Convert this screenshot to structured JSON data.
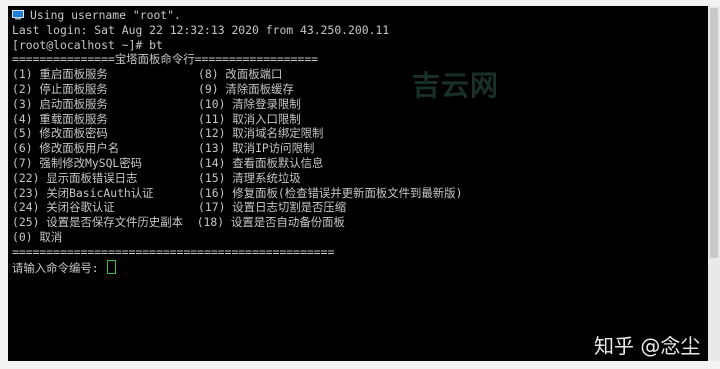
{
  "terminal": {
    "lines": {
      "l1": "Using username \"root\".",
      "l2": "Last login: Sat Aug 22 12:32:13 2020 from 43.250.200.11",
      "l3": "[root@localhost ~]# bt",
      "l4": "===============宝塔面板命令行=================="
    },
    "menu": {
      "r1": {
        "a": "(1) 重启面板服务",
        "b": "(8) 改面板端口"
      },
      "r2": {
        "a": "(2) 停止面板服务",
        "b": "(9) 清除面板缓存"
      },
      "r3": {
        "a": "(3) 启动面板服务",
        "b": "(10) 清除登录限制"
      },
      "r4": {
        "a": "(4) 重载面板服务",
        "b": "(11) 取消入口限制"
      },
      "r5": {
        "a": "(5) 修改面板密码",
        "b": "(12) 取消域名绑定限制"
      },
      "r6": {
        "a": "(6) 修改面板用户名",
        "b": "(13) 取消IP访问限制"
      },
      "r7": {
        "a": "(7) 强制修改MySQL密码",
        "b": "(14) 查看面板默认信息"
      },
      "r8": {
        "a": "(22) 显示面板错误日志",
        "b": "(15) 清理系统垃圾"
      },
      "r9": {
        "a": "(23) 关闭BasicAuth认证",
        "b": "(16) 修复面板(检查错误并更新面板文件到最新版)"
      },
      "r10": {
        "a": "(24) 关闭谷歌认证",
        "b": "(17) 设置日志切割是否压缩"
      },
      "r11": "(25) 设置是否保存文件历史副本  (18) 设置是否自动备份面板",
      "r12": "(0) 取消",
      "r13": "==============================================="
    },
    "prompt": "请输入命令编号: "
  },
  "watermarks": {
    "faint": "吉云网",
    "zhihu": "知乎 @念尘"
  },
  "colors": {
    "background": "#000000",
    "text": "#c7c7c7",
    "cursor": "#3fbf3f"
  }
}
